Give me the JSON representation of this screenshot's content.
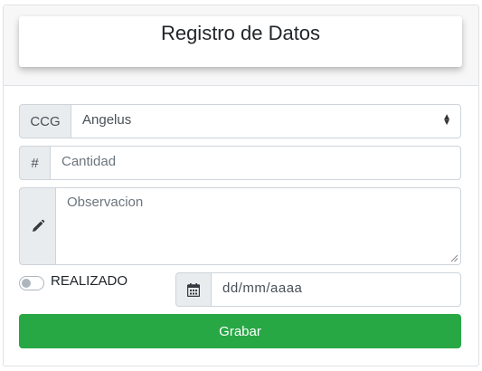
{
  "header": {
    "title": "Registro de Datos"
  },
  "form": {
    "ccg": {
      "prefix": "CCG",
      "selected": "Angelus"
    },
    "cantidad": {
      "prefix": "#",
      "placeholder": "Cantidad"
    },
    "observacion": {
      "placeholder": "Observacion"
    },
    "realizado": {
      "label": "REALIZADO",
      "checked": false
    },
    "fecha": {
      "placeholder": "dd/mm/aaaa"
    },
    "submit_label": "Grabar"
  },
  "colors": {
    "submit": "#28a745",
    "addon_bg": "#e9ecef",
    "border": "#ced4da"
  },
  "icons": {
    "observacion": "pencil-icon",
    "fecha": "calendar-icon",
    "select": "sort-arrows-icon"
  }
}
